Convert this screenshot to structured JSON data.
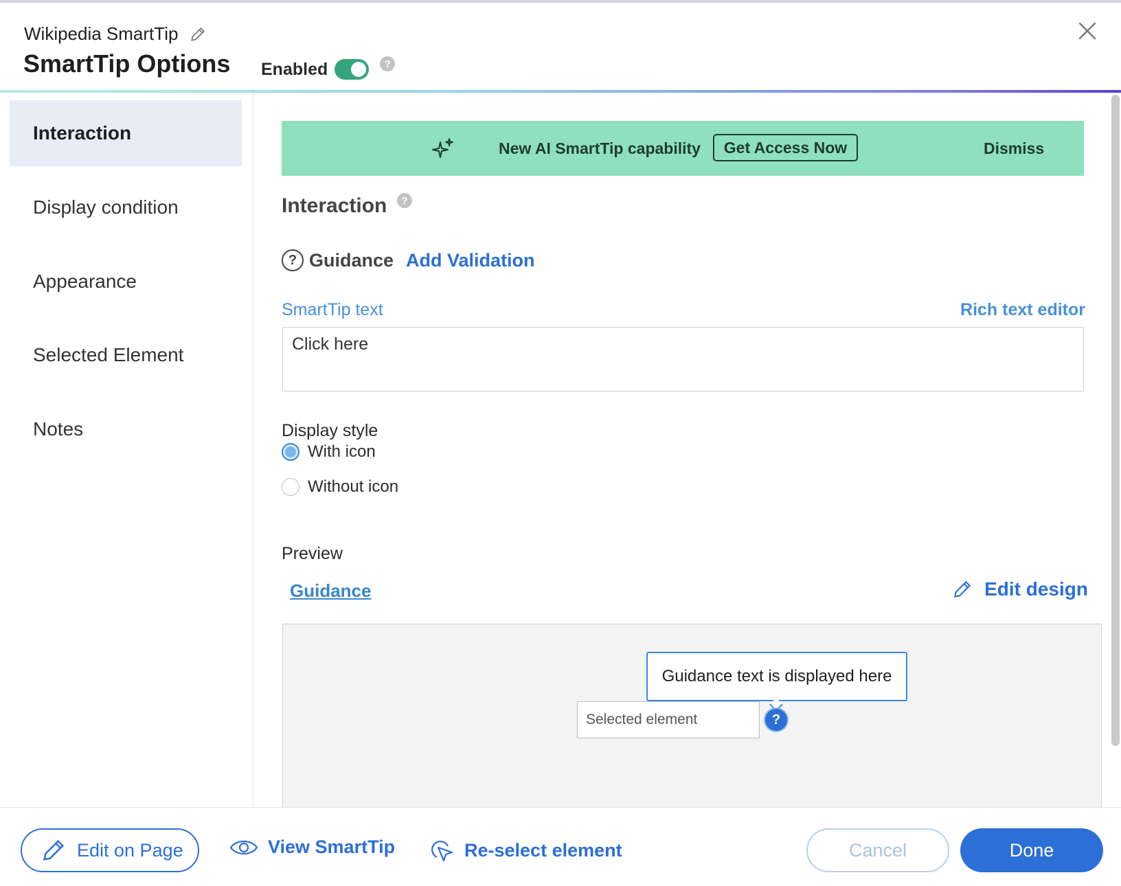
{
  "header": {
    "subtitle": "Wikipedia SmartTip",
    "title": "SmartTip Options",
    "enabled_label": "Enabled",
    "enabled": true,
    "help_glyph": "?"
  },
  "sidebar": {
    "items": [
      {
        "label": "Interaction",
        "active": true
      },
      {
        "label": "Display condition",
        "active": false
      },
      {
        "label": "Appearance",
        "active": false
      },
      {
        "label": "Selected Element",
        "active": false
      },
      {
        "label": "Notes",
        "active": false
      }
    ]
  },
  "banner": {
    "text": "New AI SmartTip capability",
    "button_label": "Get Access Now",
    "dismiss_label": "Dismiss",
    "background_color": "#8ee0be"
  },
  "main": {
    "section_title": "Interaction",
    "guidance_label": "Guidance",
    "add_validation_label": "Add Validation",
    "smarttip_text_label": "SmartTip text",
    "rich_text_editor_label": "Rich text editor",
    "smarttip_text_value": "Click here",
    "display_style_label": "Display style",
    "display_style_options": [
      {
        "label": "With icon",
        "checked": true
      },
      {
        "label": "Without icon",
        "checked": false
      }
    ],
    "preview_label": "Preview",
    "guidance_link": "Guidance",
    "edit_design_label": "Edit design"
  },
  "preview": {
    "tooltip_text": "Guidance text is displayed here",
    "selected_element_text": "Selected element",
    "icon_glyph": "?"
  },
  "footer": {
    "edit_on_page_label": "Edit on Page",
    "view_smarttip_label": "View SmartTip",
    "reselect_element_label": "Re-select element",
    "cancel_label": "Cancel",
    "done_label": "Done"
  },
  "colors": {
    "accent": "#2c6fd6",
    "toggle_on": "#35a57b"
  },
  "icons": [
    "pencil-icon",
    "close-icon",
    "help-icon",
    "sparkle-icon",
    "question-outline-icon",
    "eye-icon",
    "cursor-select-icon"
  ]
}
